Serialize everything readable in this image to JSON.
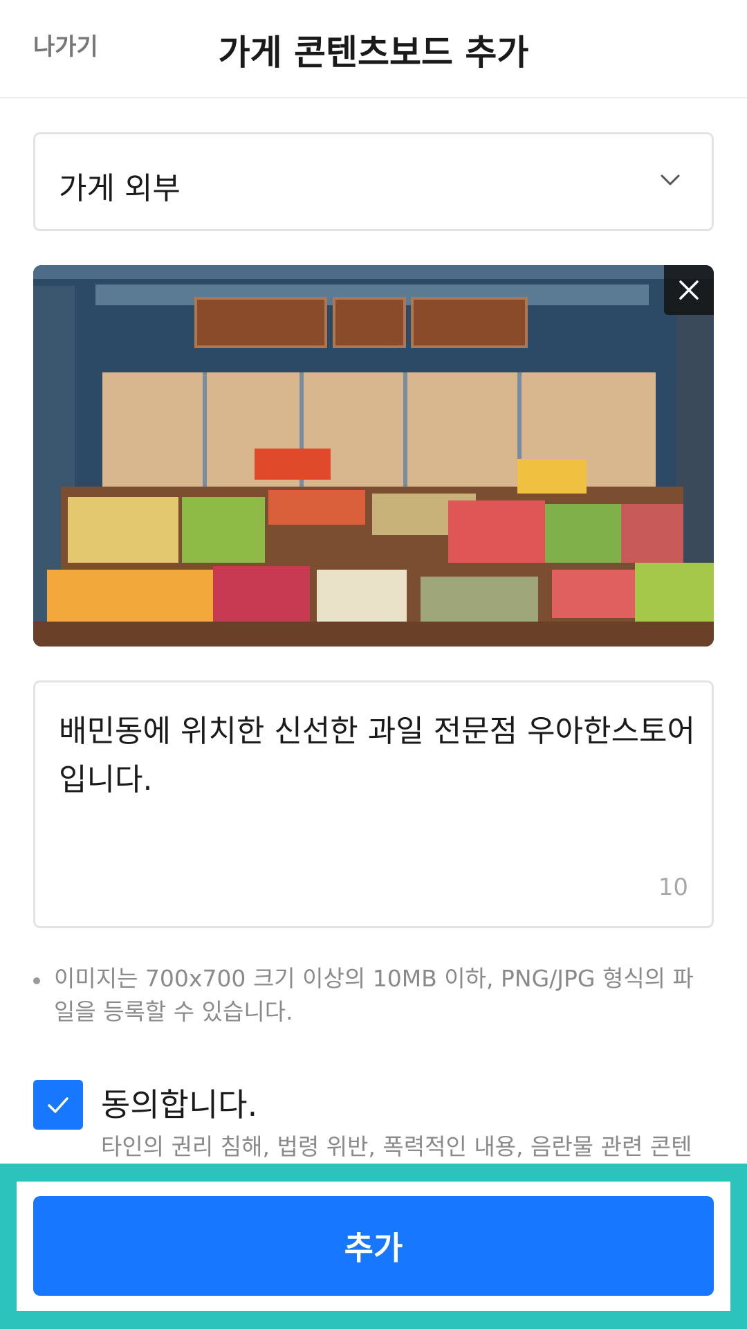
{
  "header": {
    "back_label": "나가기",
    "title": "가게 콘텐츠보드 추가"
  },
  "category_select": {
    "selected": "가게 외부",
    "icon": "chevron-down-icon"
  },
  "image_preview": {
    "alt": "과일 가게 외관 사진",
    "remove_icon": "close-icon"
  },
  "description": {
    "value": "배민동에 위치한 신선한 과일 전문점 우아한스토어입니다.",
    "char_count": "10"
  },
  "notice": {
    "text": "이미지는 700x700 크기 이상의 10MB 이하, PNG/JPG 형식의 파일을 등록할 수 있습니다."
  },
  "agree": {
    "checked": true,
    "label": "동의합니다.",
    "description": "타인의 권리 침해, 법령 위반, 폭력적인 내용, 음란물 관련 콘텐"
  },
  "submit": {
    "label": "추가"
  },
  "colors": {
    "primary": "#1877ff",
    "highlight_frame": "#2cc3bd",
    "border": "#e3e3e3",
    "muted_text": "#8a8a8a"
  }
}
